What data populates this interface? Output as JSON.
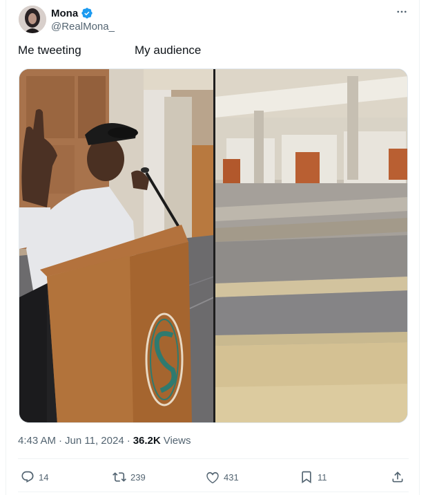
{
  "author": {
    "display_name": "Mona",
    "handle": "@RealMona_",
    "verified_badge_icon": "verified-badge-icon",
    "avatar_icon": "avatar"
  },
  "more_icon": "more-horizontal-icon",
  "tweet": {
    "caption_left": "Me tweeting",
    "caption_right": "My audience"
  },
  "meta": {
    "time": "4:43 AM",
    "separator": "·",
    "date": "Jun 11, 2024",
    "views_count": "36.2K",
    "views_label": "Views"
  },
  "actions": {
    "replies": "14",
    "reposts": "239",
    "likes": "431",
    "bookmarks": "11"
  },
  "colors": {
    "verified": "#1d9bf0",
    "text_primary": "#0f1419",
    "text_secondary": "#536471"
  }
}
